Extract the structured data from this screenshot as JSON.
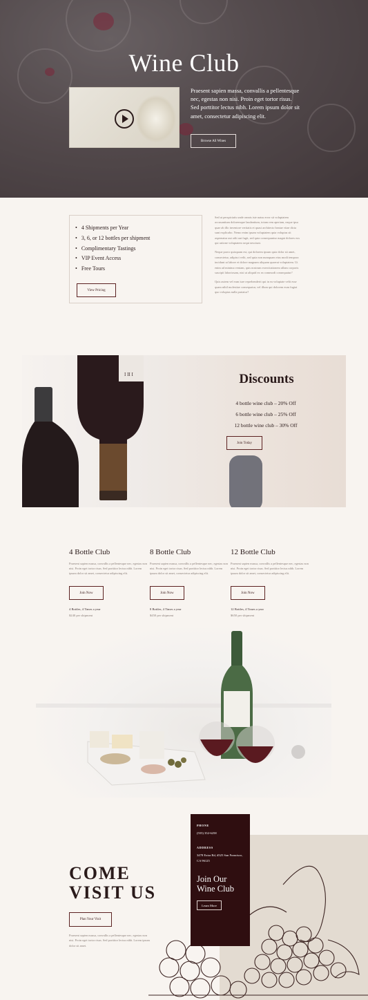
{
  "hero": {
    "title": "Wine Club",
    "text": "Praesent sapien massa, convallis a pellentesque nec, egestas non nisi. Proin eget tortor risus. Sed porttitor lectus nibh. Lorem ipsum dolor sit amet, consectetur adipiscing elit.",
    "button": "Browse All Wines"
  },
  "benefits": {
    "items": [
      "4 Shipments per Year",
      "3, 6, or 12 bottles per shipment",
      "Complimentary Tastings",
      "VIP Event Access",
      "Free Tours"
    ],
    "button": "View Pricing",
    "paragraphs": [
      "Sed ut perspiciatis unde omnis iste natus error sit voluptatem accusantium doloremque laudantium, totam rem aperiam, eaque ipsa quae ab illo inventore veritatis et quasi architecto beatae vitae dicta sunt explicabo. Nemo enim ipsam voluptatem quia voluptas sit aspernatur aut odit aut fugit, sed quia consequuntur magni dolores eos qui ratione voluptatem sequi nesciunt.",
      "Neque porro quisquam est, qui dolorem ipsum quia dolor sit amet, consectetur, adipisci velit, sed quia non numquam eius modi tempora incidunt ut labore et dolore magnam aliquam quaerat voluptatem. Ut enim ad minima veniam, quis nostrum exercitationem ullam corporis suscipit laboriosam, nisi ut aliquid ex ea commodi consequatur?",
      "Quis autem vel eum iure reprehenderit qui in ea voluptate velit esse quam nihil molestiae consequatur, vel illum qui dolorem eum fugiat quo voluptas nulla pariatur?"
    ]
  },
  "discounts": {
    "title": "Discounts",
    "lines": [
      "4 bottle wine club – 20% Off",
      "6 bottle wine club – 25% Off",
      "12 bottle wine club – 30% Off"
    ],
    "button": "Join Today"
  },
  "clubs": [
    {
      "title": "4 Bottle Club",
      "desc": "Praesent sapien massa, convallis a pellentesque nec, egestas non nisi. Proin eget tortor risus. Sed porttitor lectus nibh. Lorem ipsum dolor sit amet, consectetur adipiscing elit.",
      "button": "Join Now",
      "freq": "4 Bottles, 4 Times a year",
      "price": "$240 per shipment"
    },
    {
      "title": "8 Bottle Club",
      "desc": "Praesent sapien massa, convallis a pellentesque nec, egestas non nisi. Proin eget tortor risus. Sed porttitor lectus nibh. Lorem ipsum dolor sit amet, consectetur adipiscing elit.",
      "button": "Join Now",
      "freq": "8 Bottles, 4 Times a year",
      "price": "$450 per shipment"
    },
    {
      "title": "12 Bottle Club",
      "desc": "Praesent sapien massa, convallis a pellentesque nec, egestas non nisi. Proin eget tortor risus. Sed porttitor lectus nibh. Lorem ipsum dolor sit amet, consectetur adipiscing elit.",
      "button": "Join Now",
      "freq": "12 Bottles, 4 Times a year",
      "price": "$650 per shipment"
    }
  ],
  "visit": {
    "title_line1": "COME",
    "title_line2": "VISIT US",
    "button": "Plan Your Visit",
    "text": "Praesent sapien massa, convallis a pellentesque nec, egestas non nisi. Proin eget tortor risus. Sed porttitor lectus nibh. Lorem ipsum dolor sit amet."
  },
  "contact": {
    "phone_label": "PHONE",
    "phone": "(555) 352-6258",
    "address_label": "ADDRESS",
    "address": "3478 Extra Rd, #525 San Francisco, CA 96125",
    "heading": "Join Our Wine Club",
    "button": "Learn More"
  },
  "colors": {
    "background": "#f8f4f0",
    "accent_dark": "#2f0e10",
    "button_border": "#5a2020",
    "visit_panel": "#e3dbd1"
  }
}
